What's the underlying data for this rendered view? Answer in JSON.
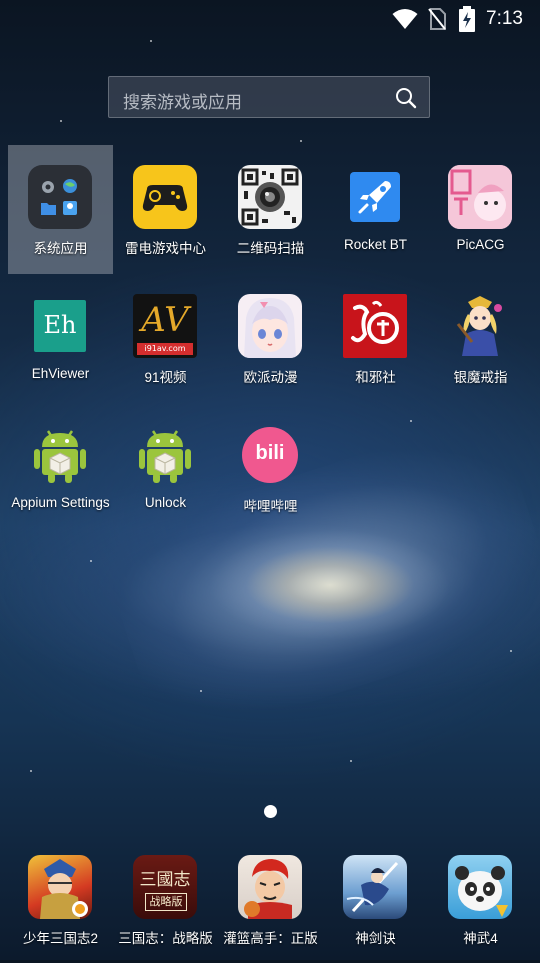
{
  "status_bar": {
    "time": "7:13"
  },
  "search": {
    "placeholder": "搜索游戏或应用"
  },
  "apps": [
    {
      "label": "系统应用",
      "icon": "folder-icon"
    },
    {
      "label": "雷电游戏中心",
      "icon": "gamepad-icon"
    },
    {
      "label": "二维码扫描",
      "icon": "qr-code-icon"
    },
    {
      "label": "Rocket BT",
      "icon": "rocket-icon"
    },
    {
      "label": "PicACG",
      "icon": "picacg-icon"
    },
    {
      "label": "EhViewer",
      "icon": "ehviewer-icon",
      "icon_text": "Eh"
    },
    {
      "label": "91视频",
      "icon": "video-icon",
      "icon_text": "AV",
      "icon_subtext": "i91av.com"
    },
    {
      "label": "欧派动漫",
      "icon": "anime-girl-icon"
    },
    {
      "label": "和邪社",
      "icon": "hexieshe-icon"
    },
    {
      "label": "银魔戒指",
      "icon": "character-icon"
    },
    {
      "label": "Appium Settings",
      "icon": "android-icon"
    },
    {
      "label": "Unlock",
      "icon": "android-icon"
    },
    {
      "label": "哔哩哔哩",
      "icon": "bilibili-icon",
      "icon_text": "bili"
    }
  ],
  "dock": [
    {
      "label": "少年三国志2",
      "icon": "game-warrior-icon"
    },
    {
      "label": "三国志：战略版",
      "icon": "sanguozhi-icon",
      "icon_text": "三國志",
      "icon_subtext": "战略版"
    },
    {
      "label": "灌篮高手：正版",
      "icon": "slam-dunk-icon"
    },
    {
      "label": "神剑诀",
      "icon": "sword-icon"
    },
    {
      "label": "神武4",
      "icon": "panda-icon"
    }
  ]
}
